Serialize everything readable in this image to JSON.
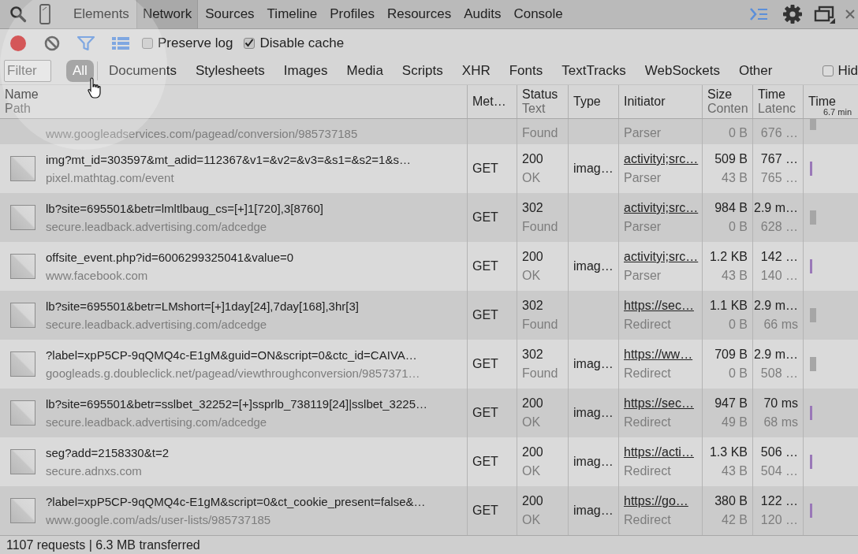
{
  "tabs": [
    {
      "label": "Elements",
      "selected": false
    },
    {
      "label": "Network",
      "selected": true
    },
    {
      "label": "Sources",
      "selected": false
    },
    {
      "label": "Timeline",
      "selected": false
    },
    {
      "label": "Profiles",
      "selected": false
    },
    {
      "label": "Resources",
      "selected": false
    },
    {
      "label": "Audits",
      "selected": false
    },
    {
      "label": "Console",
      "selected": false
    }
  ],
  "toolbar": {
    "recording": true,
    "filter_active": true,
    "large_rows": true,
    "options": [
      {
        "label": "Preserve log",
        "checked": false
      },
      {
        "label": "Disable cache",
        "checked": true
      }
    ]
  },
  "filter": {
    "placeholder": "Filter"
  },
  "types": [
    {
      "label": "All",
      "selected": true
    },
    {
      "label": "Documents",
      "selected": false
    },
    {
      "label": "Stylesheets",
      "selected": false
    },
    {
      "label": "Images",
      "selected": false
    },
    {
      "label": "Media",
      "selected": false
    },
    {
      "label": "Scripts",
      "selected": false
    },
    {
      "label": "XHR",
      "selected": false
    },
    {
      "label": "Fonts",
      "selected": false
    },
    {
      "label": "TextTracks",
      "selected": false
    },
    {
      "label": "WebSockets",
      "selected": false
    },
    {
      "label": "Other",
      "selected": false
    }
  ],
  "hide_option": {
    "label": "Hid",
    "checked": false
  },
  "columns": [
    {
      "title": "Name",
      "subtitle": "Path"
    },
    {
      "title": "Met…"
    },
    {
      "title": "Status",
      "subtitle": "Text"
    },
    {
      "title": "Type"
    },
    {
      "title": "Initiator"
    },
    {
      "title": "Size",
      "subtitle": "Conten"
    },
    {
      "title": "Time",
      "subtitle": "Latenc"
    },
    {
      "title": "Time"
    }
  ],
  "timeline_label": "6.7 min",
  "rows": [
    {
      "kind": "clipped",
      "path": "www.googleadservices.com/pagead/conversion/985737185",
      "status_text": "Found",
      "initiator_cause": "Parser",
      "content": "0 B",
      "latency": "676 …",
      "color": "#a6a6a6"
    },
    {
      "kind": "full",
      "name": "img?mt_id=303597&mt_adid=112367&v1=&v2=&v3=&s1=&s2=1&s…",
      "path": "pixel.mathtag.com/event",
      "method": "GET",
      "status": "200",
      "status_text": "OK",
      "type": "imag…",
      "initiator": "activityi;src…",
      "initiator_cause": "Parser",
      "size": "509 B",
      "content": "43 B",
      "time": "767 …",
      "latency": "765 …",
      "color": "#9a78b8"
    },
    {
      "kind": "full",
      "name": "lb?site=695501&betr=lmltlbaug_cs=[+]1[720],3[8760]",
      "path": "secure.leadback.advertising.com/adcedge",
      "method": "GET",
      "status": "302",
      "status_text": "Found",
      "initiator": "activityi;src…",
      "initiator_cause": "Parser",
      "size": "984 B",
      "content": "0 B",
      "time": "2.9 m…",
      "latency": "628 …",
      "color": "#a6a6a6"
    },
    {
      "kind": "full",
      "name": "offsite_event.php?id=6006299325041&value=0",
      "path": "www.facebook.com",
      "method": "GET",
      "status": "200",
      "status_text": "OK",
      "type": "imag…",
      "initiator": "activityi;src…",
      "initiator_cause": "Parser",
      "size": "1.2 KB",
      "content": "43 B",
      "time": "142 …",
      "latency": "140 …",
      "color": "#9a78b8"
    },
    {
      "kind": "full",
      "name": "lb?site=695501&betr=LMshort=[+]1day[24],7day[168],3hr[3]",
      "path": "secure.leadback.advertising.com/adcedge",
      "method": "GET",
      "status": "302",
      "status_text": "Found",
      "initiator": "https://sec…",
      "initiator_cause": "Redirect",
      "size": "1.1 KB",
      "content": "0 B",
      "time": "2.9 m…",
      "latency": "66 ms",
      "color": "#a6a6a6"
    },
    {
      "kind": "full",
      "name": "?label=xpP5CP-9qQMQ4c-E1gM&guid=ON&script=0&ctc_id=CAIVA…",
      "path": "googleads.g.doubleclick.net/pagead/viewthroughconversion/9857371…",
      "method": "GET",
      "status": "302",
      "status_text": "Found",
      "type": "imag…",
      "initiator": "https://ww…",
      "initiator_cause": "Redirect",
      "size": "709 B",
      "content": "0 B",
      "time": "2.9 m…",
      "latency": "508 …",
      "color": "#a6a6a6"
    },
    {
      "kind": "full",
      "name": "lb?site=695501&betr=sslbet_32252=[+]ssprlb_738119[24]|sslbet_3225…",
      "path": "secure.leadback.advertising.com/adcedge",
      "method": "GET",
      "status": "200",
      "status_text": "OK",
      "type": "imag…",
      "initiator": "https://sec…",
      "initiator_cause": "Redirect",
      "size": "947 B",
      "content": "49 B",
      "time": "70 ms",
      "latency": "68 ms",
      "color": "#9a78b8"
    },
    {
      "kind": "full",
      "name": "seg?add=2158330&t=2",
      "path": "secure.adnxs.com",
      "method": "GET",
      "status": "200",
      "status_text": "OK",
      "type": "imag…",
      "initiator": "https://acti…",
      "initiator_cause": "Redirect",
      "size": "1.3 KB",
      "content": "43 B",
      "time": "506 …",
      "latency": "504 …",
      "color": "#9a78b8"
    },
    {
      "kind": "full",
      "name": "?label=xpP5CP-9qQMQ4c-E1gM&script=0&ct_cookie_present=false&…",
      "path": "www.google.com/ads/user-lists/985737185",
      "method": "GET",
      "status": "200",
      "status_text": "OK",
      "type": "imag…",
      "initiator": "https://go…",
      "initiator_cause": "Redirect",
      "size": "380 B",
      "content": "42 B",
      "time": "122 …",
      "latency": "120 …",
      "color": "#9a78b8"
    }
  ],
  "status_bar": "1107 requests | 6.3 MB transferred"
}
